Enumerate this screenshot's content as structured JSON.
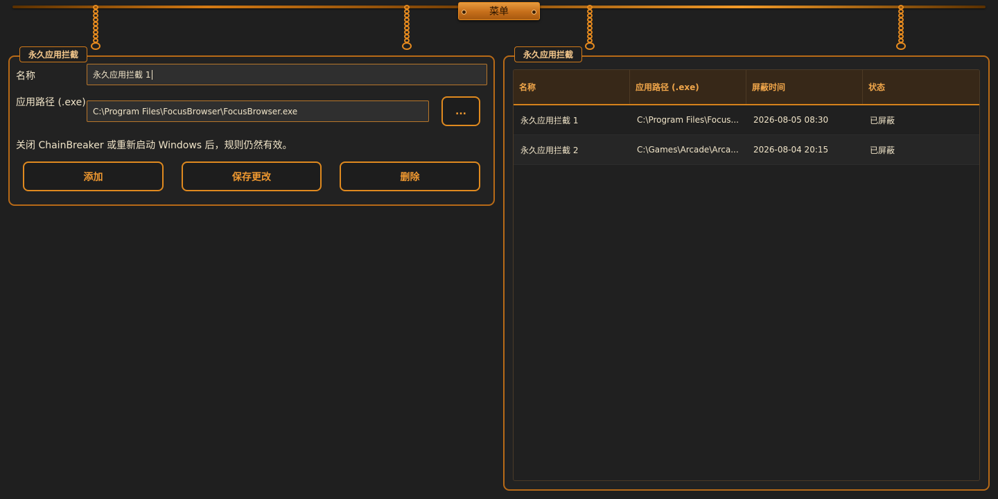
{
  "menu": {
    "label": "菜单"
  },
  "left_panel": {
    "title": "永久应用拦截",
    "name_label": "名称",
    "name_value": "永久应用拦截 1",
    "path_label": "应用路径 (.exe)",
    "path_value": "C:\\Program Files\\FocusBrowser\\FocusBrowser.exe",
    "browse_label": "...",
    "note": "关闭 ChainBreaker 或重新启动 Windows 后，规则仍然有效。",
    "buttons": {
      "add": "添加",
      "save": "保存更改",
      "delete": "删除"
    }
  },
  "right_panel": {
    "title": "永久应用拦截",
    "columns": [
      "名称",
      "应用路径 (.exe)",
      "屏蔽时间",
      "状态"
    ],
    "rows": [
      [
        "永久应用拦截 1",
        "C:\\Program Files\\Focus...",
        "2026-08-05 08:30",
        "已屏蔽"
      ],
      [
        "永久应用拦截 2",
        "C:\\Games\\Arcade\\Arca...",
        "2026-08-04 20:15",
        "已屏蔽"
      ]
    ]
  },
  "colors": {
    "accent": "#e08a1f",
    "background": "#1f1f1f",
    "header": "#372818"
  }
}
